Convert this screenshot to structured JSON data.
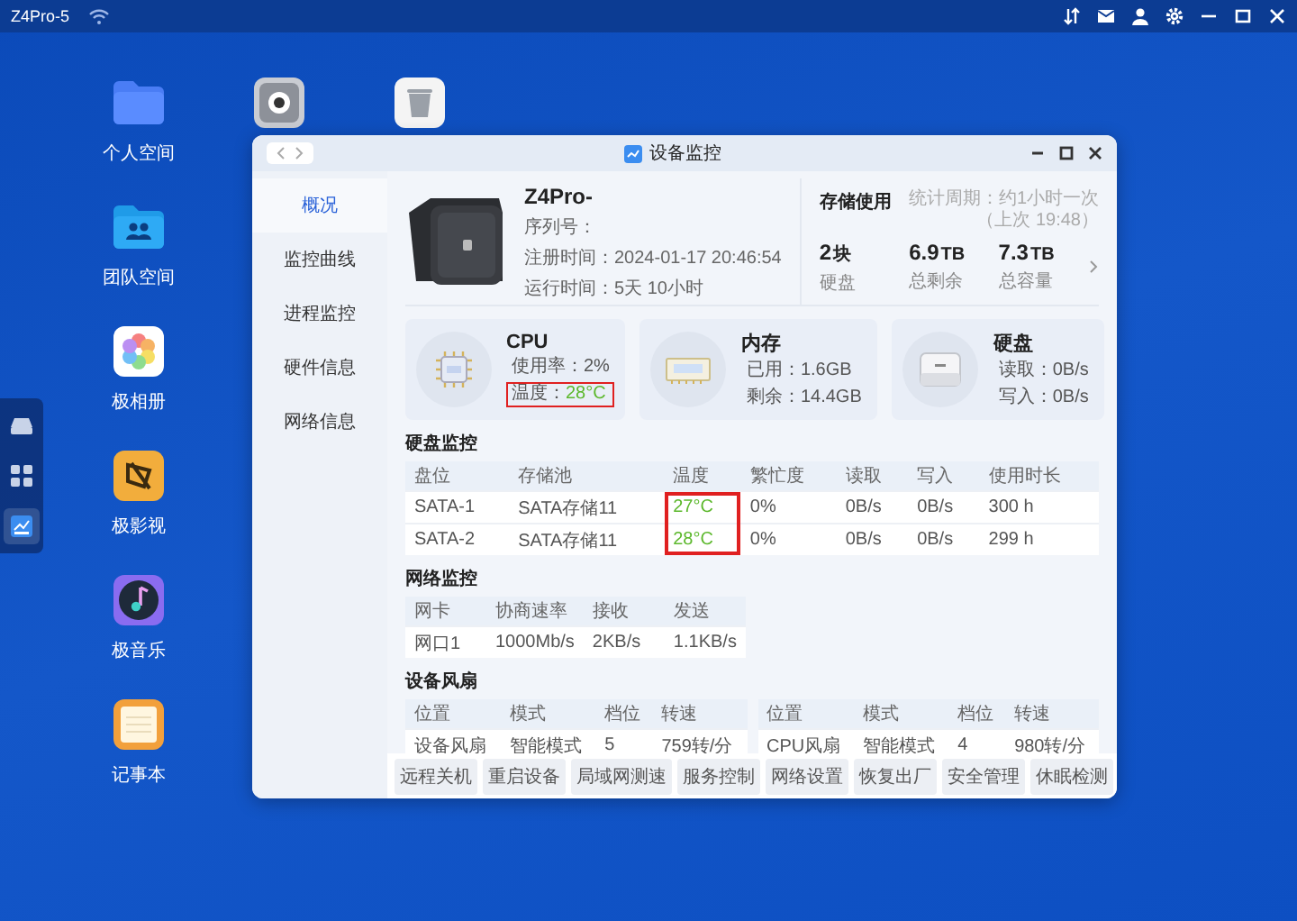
{
  "top_bar": {
    "host": "Z4Pro-5",
    "tray": [
      {
        "kind": "transfer"
      },
      {
        "kind": "mail"
      },
      {
        "kind": "user"
      },
      {
        "kind": "settings"
      },
      {
        "kind": "minimize"
      },
      {
        "kind": "maximize"
      },
      {
        "kind": "close"
      }
    ]
  },
  "desktop_icons": [
    {
      "kind": "folder",
      "label": "个人空间"
    },
    {
      "kind": "team",
      "label": "团队空间"
    },
    {
      "kind": "photos",
      "label": "极相册"
    },
    {
      "kind": "video",
      "label": "极影视"
    },
    {
      "kind": "music",
      "label": "极音乐"
    },
    {
      "kind": "notes",
      "label": "记事本"
    }
  ],
  "desktop_icons_top": [
    {
      "kind": "disc"
    },
    {
      "kind": "trash"
    }
  ],
  "dock": [
    {
      "kind": "storage",
      "selected": false
    },
    {
      "kind": "apps",
      "selected": false
    },
    {
      "kind": "monitor",
      "selected": true
    }
  ],
  "window": {
    "title": "设备监控"
  },
  "sidebar": {
    "items": [
      {
        "label": "概况",
        "selected": true
      },
      {
        "label": "监控曲线",
        "selected": false
      },
      {
        "label": "进程监控",
        "selected": false
      },
      {
        "label": "硬件信息",
        "selected": false
      },
      {
        "label": "网络信息",
        "selected": false
      }
    ]
  },
  "device": {
    "name": "Z4Pro-",
    "serial_label": "序列号：",
    "registered": "注册时间：2024-01-17 20:46:54",
    "uptime": "运行时间：5天 10小时"
  },
  "storage": {
    "title": "存储使用",
    "period": "统计周期：约1小时一次（上次 19:48）",
    "stats": [
      {
        "value": "2",
        "unit": "块",
        "label": "硬盘"
      },
      {
        "value": "6.9",
        "unit": "TB",
        "label": "总剩余"
      },
      {
        "value": "7.3",
        "unit": "TB",
        "label": "总容量"
      }
    ]
  },
  "resources": [
    {
      "kind": "cpu",
      "title": "CPU",
      "lines": [
        {
          "label": "使用率：",
          "value": "2%",
          "highlighted": false
        },
        {
          "label": "温度：",
          "value": "28°C",
          "color": "#5cb82c",
          "highlighted": true
        }
      ]
    },
    {
      "kind": "ram",
      "title": "内存",
      "lines": [
        {
          "label": "已用：",
          "value": "1.6GB",
          "highlighted": false
        },
        {
          "label": "剩余：",
          "value": "14.4GB",
          "highlighted": false
        }
      ]
    },
    {
      "kind": "disk",
      "title": "硬盘",
      "lines": [
        {
          "label": "读取：",
          "value": "0B/s",
          "highlighted": false
        },
        {
          "label": "写入：",
          "value": "0B/s",
          "highlighted": false
        }
      ]
    }
  ],
  "disk_monitor": {
    "title": "硬盘监控",
    "temperature_highlighted": true,
    "columns": [
      "盘位",
      "存储池",
      "温度",
      "繁忙度",
      "读取",
      "写入",
      "使用时长"
    ],
    "rows": [
      {
        "bay": "SATA-1",
        "pool": "SATA存储11",
        "temperature": "27°C",
        "color": "#5cb82c",
        "busy": "0%",
        "read": "0B/s",
        "write": "0B/s",
        "usage_time": "300 h"
      },
      {
        "bay": "SATA-2",
        "pool": "SATA存储11",
        "temperature": "28°C",
        "color": "#5cb82c",
        "busy": "0%",
        "read": "0B/s",
        "write": "0B/s",
        "usage_time": "299 h"
      }
    ]
  },
  "network_monitor": {
    "title": "网络监控",
    "columns": [
      "网卡",
      "协商速率",
      "接收",
      "发送"
    ],
    "rows": [
      [
        "网口1",
        "1000Mb/s",
        "2KB/s",
        "1.1KB/s"
      ]
    ]
  },
  "fans": {
    "title": "设备风扇",
    "tables": [
      {
        "columns": [
          "位置",
          "模式",
          "档位",
          "转速"
        ],
        "rows": [
          [
            "设备风扇",
            "智能模式",
            "5",
            "759转/分"
          ]
        ]
      },
      {
        "columns": [
          "位置",
          "模式",
          "档位",
          "转速"
        ],
        "rows": [
          [
            "CPU风扇",
            "智能模式",
            "4",
            "980转/分"
          ]
        ]
      }
    ]
  },
  "actions": [
    "远程关机",
    "重启设备",
    "局域网测速",
    "服务控制",
    "网络设置",
    "恢复出厂",
    "安全管理",
    "休眠检测"
  ]
}
